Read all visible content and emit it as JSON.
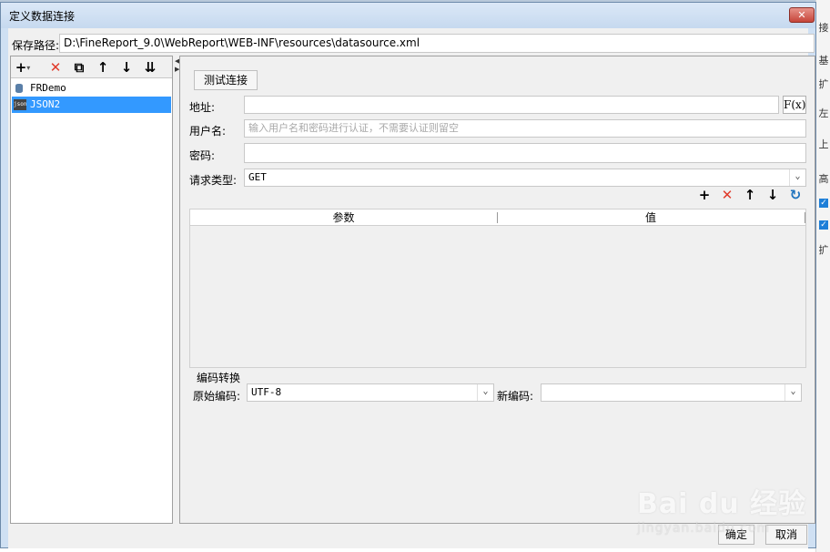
{
  "dialog": {
    "title": "定义数据连接",
    "close_label": "✕",
    "save_path_label": "保存路径:",
    "save_path": "D:\\FineReport_9.0\\WebReport\\WEB-INF\\resources\\datasource.xml"
  },
  "toolbar": {
    "add": "+",
    "add_arrow": "▾",
    "delete": "✕",
    "copy": "⧉",
    "move_up": "↑",
    "move_down": "↓",
    "sort": "⇊"
  },
  "datasources": [
    {
      "name": "FRDemo",
      "icon": "database-icon",
      "selected": false
    },
    {
      "name": "JSON2",
      "icon": "json-icon",
      "icon_text": "json",
      "selected": true
    }
  ],
  "form": {
    "test_button": "测试连接",
    "address_label": "地址:",
    "address_value": "",
    "fx_label": "F(x)",
    "username_label": "用户名:",
    "username_placeholder": "输入用户名和密码进行认证，不需要认证则留空",
    "password_label": "密码:",
    "password_value": "",
    "request_type_label": "请求类型:",
    "request_type_value": "GET"
  },
  "params": {
    "toolbar": {
      "add": "+",
      "delete": "✕",
      "up": "↑",
      "down": "↓",
      "refresh": "↻"
    },
    "columns": [
      "参数",
      "值"
    ],
    "rows": []
  },
  "encoding": {
    "section_label": "编码转换",
    "original_label": "原始编码:",
    "original_value": "UTF-8",
    "new_label": "新编码:",
    "new_value": ""
  },
  "footer": {
    "ok": "确定",
    "cancel": "取消"
  },
  "watermark": {
    "main": "Bai du 经验",
    "sub": "jingyan.baidu.com"
  },
  "background": {
    "glyphs": [
      "接",
      "基",
      "扩",
      "左",
      "上",
      "高",
      "✓",
      "✓",
      "扩"
    ]
  },
  "colors": {
    "accent": "#3399ff",
    "delete_red": "#e03a2a",
    "refresh_blue": "#1e73be",
    "title_bar": "#cfe0f3"
  }
}
